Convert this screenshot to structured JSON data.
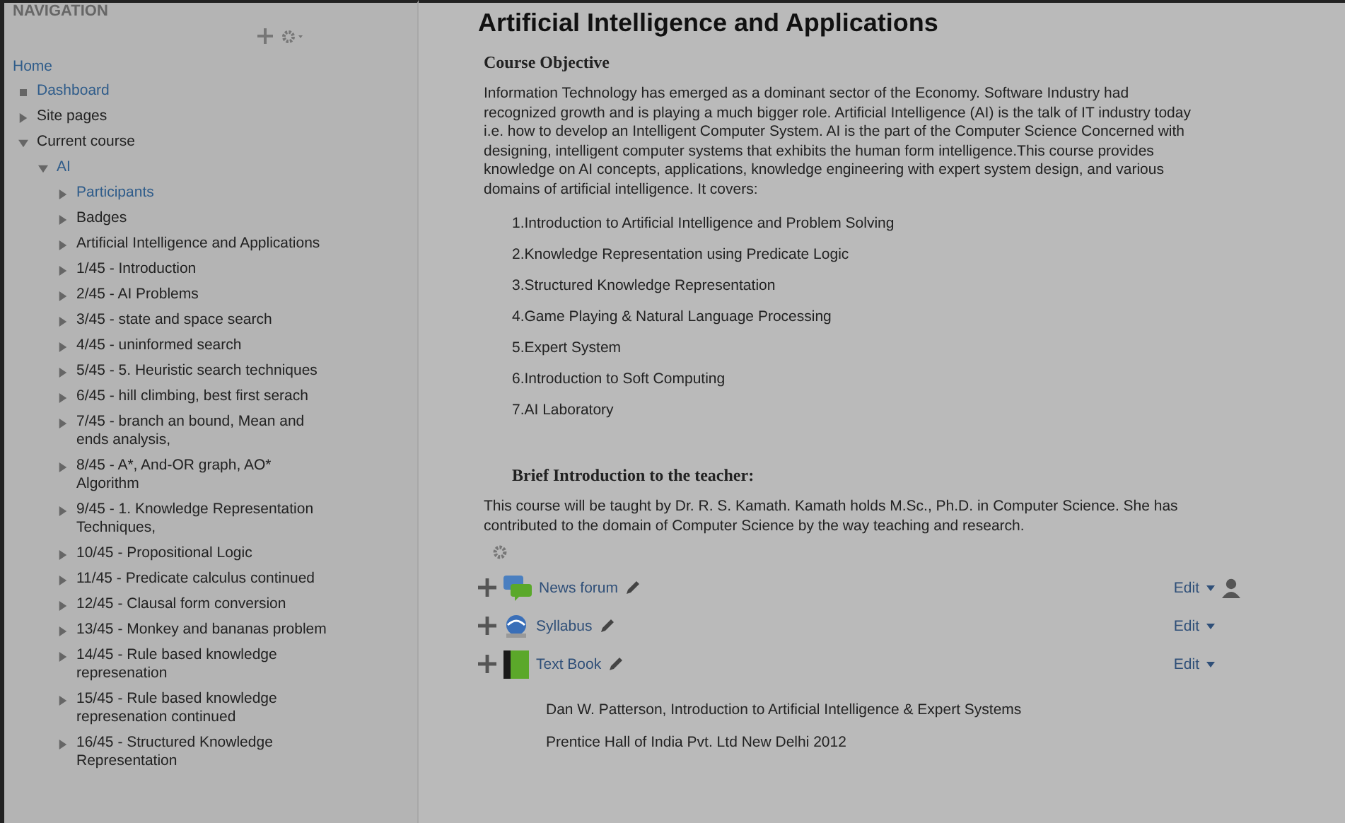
{
  "navigation": {
    "title": "NAVIGATION",
    "home": "Home",
    "tree": [
      {
        "label": "Dashboard",
        "kind": "leaf",
        "link": true
      },
      {
        "label": "Site pages",
        "kind": "branch",
        "expanded": false,
        "link": false
      },
      {
        "label": "Current course",
        "kind": "branch",
        "expanded": true,
        "link": false,
        "children": [
          {
            "label": "AI",
            "kind": "branch",
            "expanded": true,
            "link": true,
            "children": [
              {
                "label": "Participants",
                "kind": "branch",
                "expanded": false,
                "link": true
              },
              {
                "label": "Badges",
                "kind": "branch",
                "expanded": false,
                "link": false
              },
              {
                "label": "Artificial Intelligence and Applications",
                "kind": "branch",
                "expanded": false,
                "link": false
              },
              {
                "label": "1/45 - Introduction",
                "kind": "branch",
                "expanded": false,
                "link": false
              },
              {
                "label": "2/45 - AI Problems",
                "kind": "branch",
                "expanded": false,
                "link": false
              },
              {
                "label": "3/45 - state and space search",
                "kind": "branch",
                "expanded": false,
                "link": false
              },
              {
                "label": "4/45 - uninformed search",
                "kind": "branch",
                "expanded": false,
                "link": false
              },
              {
                "label": "5/45 - 5. Heuristic search techniques",
                "kind": "branch",
                "expanded": false,
                "link": false
              },
              {
                "label": "6/45 - hill climbing, best first serach",
                "kind": "branch",
                "expanded": false,
                "link": false
              },
              {
                "label": "7/45 - branch an bound, Mean and ends analysis,",
                "kind": "branch",
                "expanded": false,
                "link": false
              },
              {
                "label": "8/45 - A*, And-OR graph, AO* Algorithm",
                "kind": "branch",
                "expanded": false,
                "link": false
              },
              {
                "label": "9/45 - 1. Knowledge Representation Techniques,",
                "kind": "branch",
                "expanded": false,
                "link": false
              },
              {
                "label": "10/45 - Propositional Logic",
                "kind": "branch",
                "expanded": false,
                "link": false
              },
              {
                "label": "11/45 - Predicate calculus continued",
                "kind": "branch",
                "expanded": false,
                "link": false
              },
              {
                "label": "12/45 - Clausal form conversion",
                "kind": "branch",
                "expanded": false,
                "link": false
              },
              {
                "label": "13/45 - Monkey and bananas problem",
                "kind": "branch",
                "expanded": false,
                "link": false
              },
              {
                "label": "14/45 - Rule based knowledge represenation",
                "kind": "branch",
                "expanded": false,
                "link": false
              },
              {
                "label": "15/45 - Rule based knowledge represenation continued",
                "kind": "branch",
                "expanded": false,
                "link": false
              },
              {
                "label": "16/45 - Structured Knowledge Representation",
                "kind": "branch",
                "expanded": false,
                "link": false
              }
            ]
          }
        ]
      }
    ]
  },
  "main": {
    "title": "Artificial Intelligence and Applications",
    "objective_heading": "Course Objective",
    "objective_text": "Information Technology has emerged as a dominant sector of the Economy. Software Industry had recognized growth and is playing a much bigger role. Artificial Intelligence (AI) is the talk of IT industry today i.e. how to develop an Intelligent Computer System. AI is the part of the Computer Science Concerned with designing, intelligent computer systems that exhibits the human form intelligence.This course provides knowledge on AI concepts, applications, knowledge engineering with expert system design, and various domains of artificial intelligence. It covers:",
    "topics": [
      "1.Introduction to Artificial Intelligence and Problem Solving",
      "2.Knowledge Representation using Predicate Logic",
      "3.Structured Knowledge Representation",
      "4.Game Playing & Natural Language Processing",
      "5.Expert System",
      "6.Introduction to Soft Computing",
      "7.AI Laboratory"
    ],
    "teacher_heading": "Brief Introduction to the teacher:",
    "teacher_text": "This course will be taught by Dr. R. S. Kamath. Kamath holds M.Sc., Ph.D. in Computer Science. She has contributed to the domain of Computer Science by the way teaching and research.",
    "activities": [
      {
        "name": "News forum",
        "kind": "forum",
        "edit": "Edit",
        "user_icon": true
      },
      {
        "name": "Syllabus",
        "kind": "url",
        "edit": "Edit",
        "user_icon": false
      },
      {
        "name": "Text Book",
        "kind": "book",
        "edit": "Edit",
        "user_icon": false
      }
    ],
    "book_lines": [
      "Dan W. Patterson,  Introduction to Artificial Intelligence & Expert Systems",
      "Prentice Hall of India Pvt. Ltd New Delhi 2012"
    ]
  }
}
